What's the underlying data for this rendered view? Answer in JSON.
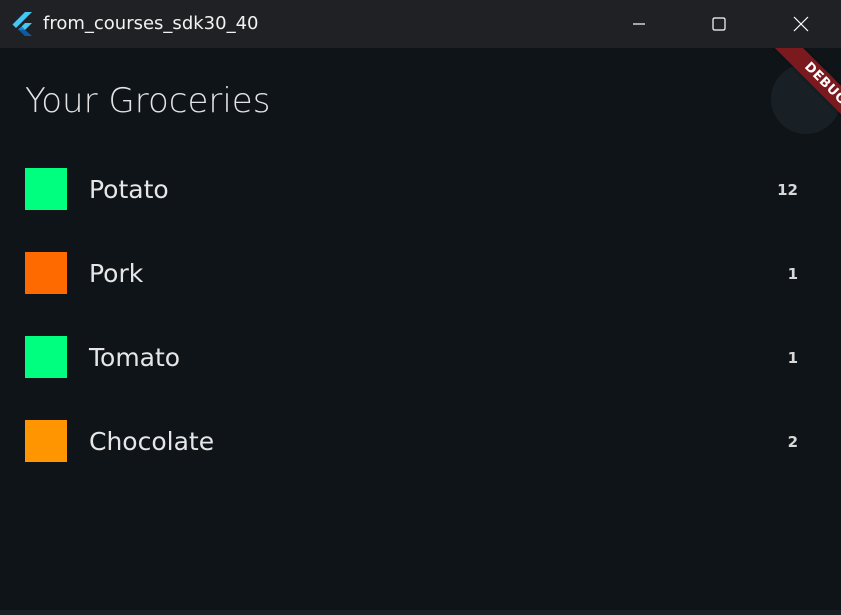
{
  "window": {
    "title": "from_courses_sdk30_40"
  },
  "page": {
    "title": "Your Groceries"
  },
  "debug_banner": {
    "label": "DEBUG"
  },
  "groceries": [
    {
      "name": "Potato",
      "quantity": "12",
      "color": "#00ff7f"
    },
    {
      "name": "Pork",
      "quantity": "1",
      "color": "#ff6a00"
    },
    {
      "name": "Tomato",
      "quantity": "1",
      "color": "#00ff7f"
    },
    {
      "name": "Chocolate",
      "quantity": "2",
      "color": "#ff9500"
    }
  ]
}
